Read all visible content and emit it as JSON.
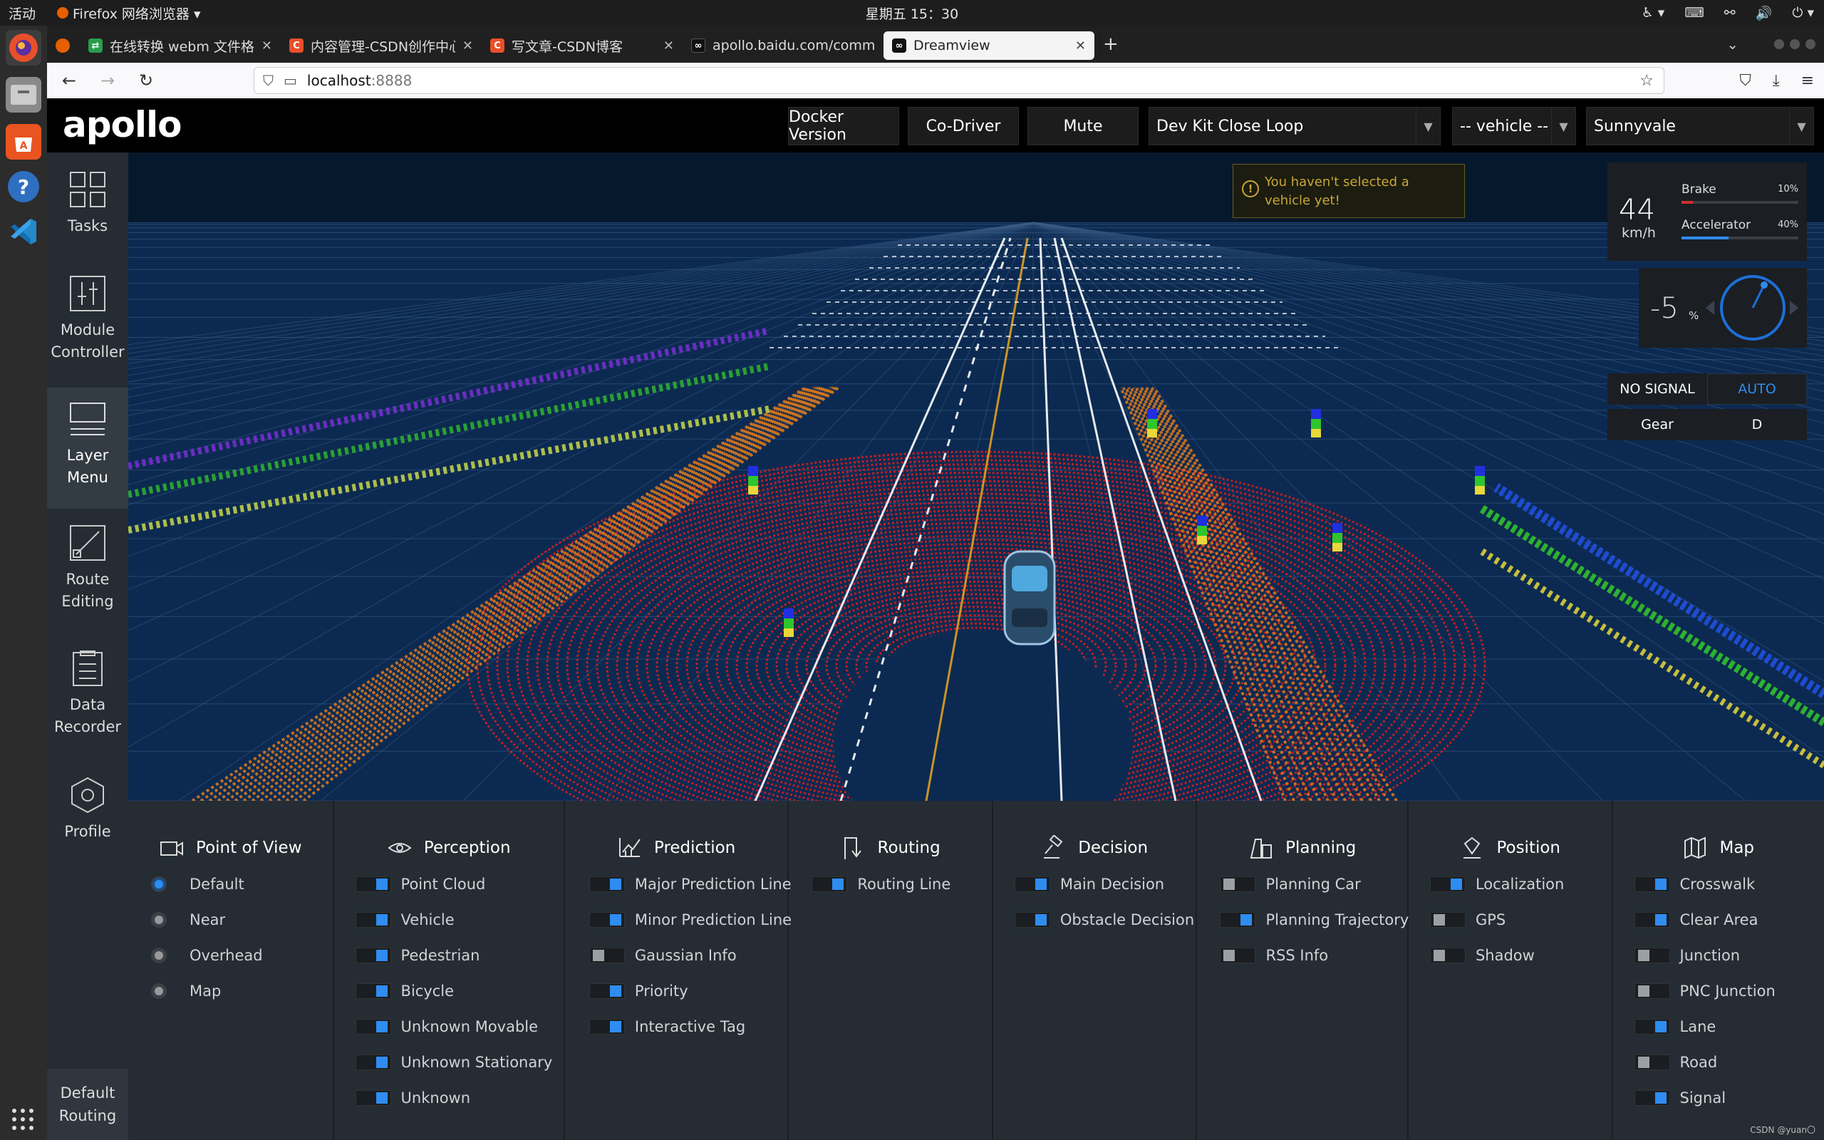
{
  "system": {
    "activities": "活动",
    "app_menu": "Firefox 网络浏览器 ▾",
    "clock": "星期五 15：30"
  },
  "browser": {
    "tabs": [
      {
        "label": "在线转换 webm 文件格式",
        "color": "#2a9d4b"
      },
      {
        "label": "内容管理-CSDN创作中心",
        "color": "#e8502a"
      },
      {
        "label": "写文章-CSDN博客",
        "color": "#e8502a"
      },
      {
        "label": "apollo.baidu.com/comm",
        "color": "#111111"
      },
      {
        "label": "Dreamview",
        "color": "#111111"
      }
    ],
    "url_host": "localhost",
    "url_port": ":8888"
  },
  "header": {
    "logo": "apollo",
    "docker_version": "Docker Version",
    "co_driver": "Co-Driver",
    "mute": "Mute",
    "mode_select": "Dev Kit Close Loop",
    "vehicle_select": "-- vehicle --",
    "map_select": "Sunnyvale"
  },
  "sidebar": {
    "items": [
      {
        "label": "Tasks",
        "icon": "tasks-icon"
      },
      {
        "label": "Module Controller",
        "icon": "module-controller-icon"
      },
      {
        "label": "Layer Menu",
        "icon": "layer-menu-icon"
      },
      {
        "label": "Route Editing",
        "icon": "route-editing-icon"
      },
      {
        "label": "Data Recorder",
        "icon": "data-recorder-icon"
      },
      {
        "label": "Profile",
        "icon": "profile-icon"
      }
    ],
    "default_routing": "Default Routing"
  },
  "alert": {
    "text": "You haven't selected a vehicle yet!"
  },
  "dashboard": {
    "speed": "44",
    "speed_unit": "km/h",
    "brake_label": "Brake",
    "brake_pct": "10%",
    "brake_value": 0.1,
    "accel_label": "Accelerator",
    "accel_pct": "40%",
    "accel_value": 0.4,
    "steering": "-5",
    "steering_unit": "%",
    "signal": "NO SIGNAL",
    "drive_mode": "AUTO",
    "gear_label": "Gear",
    "gear": "D",
    "colors": {
      "brake": "#d0302f",
      "accel": "#2f8cf0",
      "accent": "#2f8cf0"
    }
  },
  "layers": {
    "point_of_view": {
      "title": "Point of View",
      "options": [
        {
          "label": "Default",
          "selected": true
        },
        {
          "label": "Near",
          "selected": false
        },
        {
          "label": "Overhead",
          "selected": false
        },
        {
          "label": "Map",
          "selected": false
        }
      ]
    },
    "perception": {
      "title": "Perception",
      "items": [
        {
          "label": "Point Cloud",
          "on": true
        },
        {
          "label": "Vehicle",
          "on": true
        },
        {
          "label": "Pedestrian",
          "on": true
        },
        {
          "label": "Bicycle",
          "on": true
        },
        {
          "label": "Unknown Movable",
          "on": true
        },
        {
          "label": "Unknown Stationary",
          "on": true
        },
        {
          "label": "Unknown",
          "on": true
        }
      ]
    },
    "prediction": {
      "title": "Prediction",
      "items": [
        {
          "label": "Major Prediction Line",
          "on": true
        },
        {
          "label": "Minor Prediction Line",
          "on": true
        },
        {
          "label": "Gaussian Info",
          "on": false
        },
        {
          "label": "Priority",
          "on": true
        },
        {
          "label": "Interactive Tag",
          "on": true
        }
      ]
    },
    "routing": {
      "title": "Routing",
      "items": [
        {
          "label": "Routing Line",
          "on": true
        }
      ]
    },
    "decision": {
      "title": "Decision",
      "items": [
        {
          "label": "Main Decision",
          "on": true
        },
        {
          "label": "Obstacle Decision",
          "on": true
        }
      ]
    },
    "planning": {
      "title": "Planning",
      "items": [
        {
          "label": "Planning Car",
          "on": false
        },
        {
          "label": "Planning Trajectory",
          "on": true
        },
        {
          "label": "RSS Info",
          "on": false
        }
      ]
    },
    "position": {
      "title": "Position",
      "items": [
        {
          "label": "Localization",
          "on": true
        },
        {
          "label": "GPS",
          "on": false
        },
        {
          "label": "Shadow",
          "on": false
        }
      ]
    },
    "map": {
      "title": "Map",
      "items": [
        {
          "label": "Crosswalk",
          "on": true
        },
        {
          "label": "Clear Area",
          "on": true
        },
        {
          "label": "Junction",
          "on": false
        },
        {
          "label": "PNC Junction",
          "on": false
        },
        {
          "label": "Lane",
          "on": true
        },
        {
          "label": "Road",
          "on": false
        },
        {
          "label": "Signal",
          "on": true
        }
      ]
    }
  },
  "watermark": "CSDN @yuan〇"
}
